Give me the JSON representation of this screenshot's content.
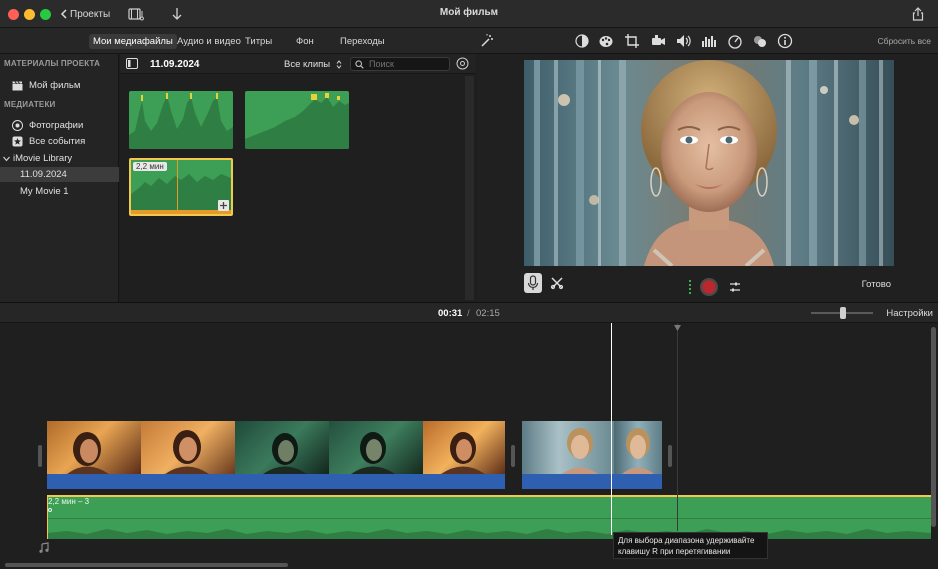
{
  "window": {
    "title": "Мой фильм",
    "back_label": "Проекты",
    "share_icon": "share-icon"
  },
  "tabs": [
    {
      "label": "Мои медиафайлы",
      "active": true
    },
    {
      "label": "Аудио и видео",
      "active": false
    },
    {
      "label": "Титры",
      "active": false
    },
    {
      "label": "Фон",
      "active": false
    },
    {
      "label": "Переходы",
      "active": false
    }
  ],
  "viewer_tools": [
    "magic-wand-icon",
    "color-balance-icon",
    "color-correction-icon",
    "crop-icon",
    "stabilization-icon",
    "volume-icon",
    "equalizer-icon",
    "speed-icon",
    "noise-reduction-icon",
    "info-icon"
  ],
  "reset_all_label": "Сбросить все",
  "sidebar": {
    "section_project": "МАТЕРИАЛЫ ПРОЕКТА",
    "project_item": "Мой фильм",
    "section_libraries": "МЕДИАТЕКИ",
    "photos_item": "Фотографии",
    "all_events_item": "Все события",
    "library_item": "iMovie Library",
    "event_date_item": "11.09.2024",
    "my_movie_item": "My Movie 1"
  },
  "browser": {
    "date": "11.09.2024",
    "filter_label": "Все клипы",
    "search_placeholder": "Поиск",
    "selected_clip_duration": "2,2 мин"
  },
  "viewer": {
    "done_label": "Готово"
  },
  "timeline_header": {
    "current_time": "00:31",
    "separator": "/",
    "total_time": "02:15",
    "settings_label": "Настройки"
  },
  "timeline": {
    "audio_clip_label": "2,2 мин – 3",
    "tooltip_line1": "Для выбора диапазона удерживайте",
    "tooltip_line2": "клавишу R при перетягивании"
  },
  "colors": {
    "accent_green": "#3d9f55",
    "audio_blue": "#2f5fb0",
    "selection_yellow": "#f2c94c",
    "record_red": "#b8282e"
  }
}
